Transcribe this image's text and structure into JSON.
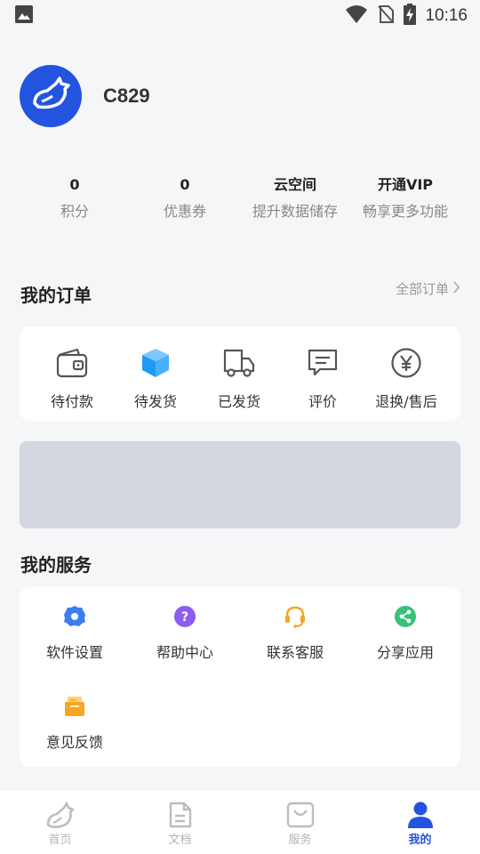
{
  "status_bar": {
    "time": "10:16",
    "icons": [
      "image-icon",
      "wifi-icon",
      "no-sim-icon",
      "battery-charging-icon"
    ]
  },
  "profile": {
    "username": "C829",
    "avatar_icon": "horse-logo-icon",
    "avatar_color": "#2254e0"
  },
  "stats": [
    {
      "value": "0",
      "label": "积分"
    },
    {
      "value": "0",
      "label": "优惠券"
    },
    {
      "value": "云空间",
      "label": "提升数据储存"
    },
    {
      "value": "开通VIP",
      "label": "畅享更多功能"
    }
  ],
  "orders": {
    "title": "我的订单",
    "all_label": "全部订单",
    "items": [
      {
        "label": "待付款",
        "icon": "wallet-icon"
      },
      {
        "label": "待发货",
        "icon": "package-icon"
      },
      {
        "label": "已发货",
        "icon": "truck-icon"
      },
      {
        "label": "评价",
        "icon": "comment-icon"
      },
      {
        "label": "退换/售后",
        "icon": "yen-icon"
      }
    ]
  },
  "services": {
    "title": "我的服务",
    "items": [
      {
        "label": "软件设置",
        "icon": "settings-icon",
        "color": "#3c7df0"
      },
      {
        "label": "帮助中心",
        "icon": "help-icon",
        "color": "#8e5cf0"
      },
      {
        "label": "联系客服",
        "icon": "headset-icon",
        "color": "#f5a623"
      },
      {
        "label": "分享应用",
        "icon": "share-icon",
        "color": "#36c27a"
      },
      {
        "label": "意见反馈",
        "icon": "feedback-icon",
        "color": "#f5a623"
      }
    ]
  },
  "tabbar": {
    "items": [
      {
        "label": "首页",
        "icon": "home-horse-icon"
      },
      {
        "label": "文档",
        "icon": "document-icon"
      },
      {
        "label": "服务",
        "icon": "bag-icon"
      },
      {
        "label": "我的",
        "icon": "user-icon"
      }
    ],
    "active": "我的",
    "active_color": "#2254e0"
  }
}
